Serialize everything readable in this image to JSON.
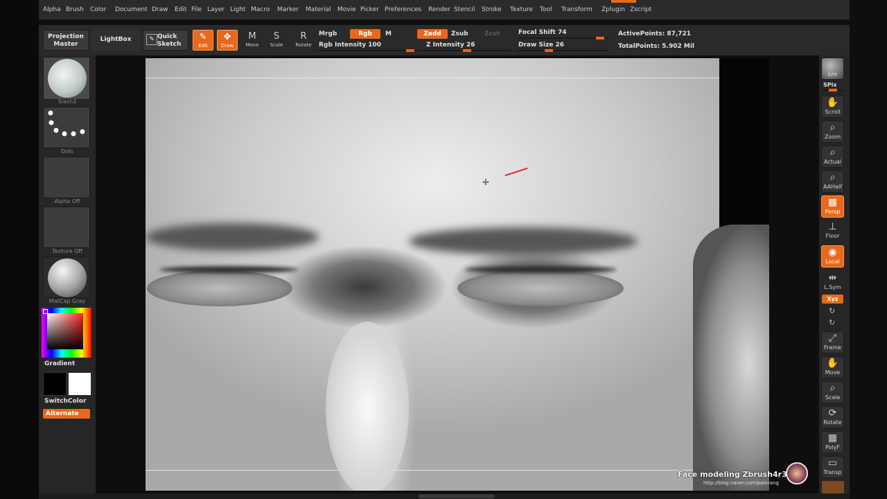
{
  "menu": [
    "Alpha",
    "Brush",
    "Color",
    "Document",
    "Draw",
    "Edit",
    "File",
    "Layer",
    "Light",
    "Macro",
    "Marker",
    "Material",
    "Movie",
    "Picker",
    "Preferences",
    "Render",
    "Stencil",
    "Stroke",
    "Texture",
    "Tool",
    "Transform",
    "Zplugin",
    "Zscript"
  ],
  "shelf": {
    "projection_master": "Projection Master",
    "lightbox": "LightBox",
    "quick_sketch": "Quick Sketch",
    "tools": [
      {
        "icon": "edit-icon",
        "label": "Edit",
        "on": true
      },
      {
        "icon": "draw-icon",
        "label": "Draw",
        "on": true
      },
      {
        "icon": "move-icon",
        "label": "Move",
        "on": false
      },
      {
        "icon": "scale-icon",
        "label": "Scale",
        "on": false
      },
      {
        "icon": "rotate-icon",
        "label": "Rotate",
        "on": false
      }
    ],
    "mrgb": "Mrgb",
    "rgb": "Rgb",
    "m": "M",
    "rgb_intensity_label": "Rgb Intensity",
    "rgb_intensity": "100",
    "zadd": "Zadd",
    "zsub": "Zsub",
    "zcut": "Zcut",
    "z_intensity_label": "Z Intensity",
    "z_intensity": "26",
    "focal_shift_label": "Focal Shift",
    "focal_shift": "74",
    "draw_size_label": "Draw Size",
    "draw_size": "26",
    "active_points_label": "ActivePoints:",
    "active_points": "87,721",
    "total_points_label": "TotalPoints:",
    "total_points": "5.902 Mil"
  },
  "left": {
    "brush": "Slash3",
    "stroke": "Dots",
    "alpha": "Alpha  Off",
    "texture": "Texture  Off",
    "material": "MatCap  Gray",
    "gradient": "Gradient",
    "switch_color": "SwitchColor",
    "alternate": "Alternate",
    "main_color": "#000000",
    "secondary_color": "#ffffff"
  },
  "right": [
    {
      "label": "BPR",
      "icon": "bpr-icon",
      "on": false
    },
    {
      "label": "Scroll",
      "icon": "scroll-icon",
      "on": false
    },
    {
      "label": "Zoom",
      "icon": "zoom-icon",
      "on": false
    },
    {
      "label": "Actual",
      "icon": "actual-icon",
      "on": false
    },
    {
      "label": "AAHalf",
      "icon": "aahalf-icon",
      "on": false
    },
    {
      "label": "Persp",
      "icon": "persp-icon",
      "on": true
    },
    {
      "label": "Floor",
      "icon": "floor-icon",
      "on": false
    },
    {
      "label": "Local",
      "icon": "local-icon",
      "on": true
    },
    {
      "label": "L.Sym",
      "icon": "lsym-icon",
      "on": false
    },
    {
      "label": "Frame",
      "icon": "frame-icon",
      "on": false
    },
    {
      "label": "Move",
      "icon": "move-icon",
      "on": false
    },
    {
      "label": "Scale",
      "icon": "scale-icon",
      "on": false
    },
    {
      "label": "Rotate",
      "icon": "rotate-icon",
      "on": false
    },
    {
      "label": "PolyF",
      "icon": "polyf-icon",
      "on": false
    },
    {
      "label": "Transp",
      "icon": "transp-icon",
      "on": false
    }
  ],
  "right_extra": {
    "spix": "SPix",
    "xyz": "Xyz"
  },
  "watermark": {
    "title": "Face modeling Zbrush4r3",
    "url": "http://blog.naver.com/painrang"
  }
}
